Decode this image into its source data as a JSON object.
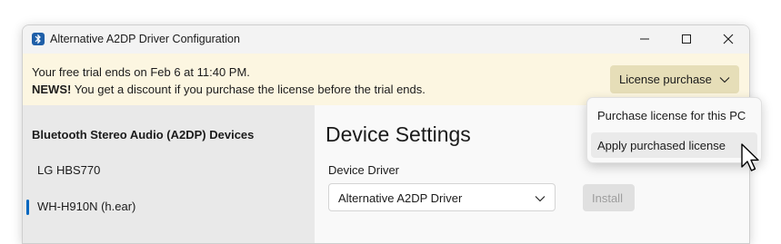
{
  "window": {
    "title": "Alternative A2DP Driver Configuration",
    "icon": "bluetooth-icon",
    "controls": [
      "minimize-icon",
      "maximize-icon",
      "close-icon"
    ]
  },
  "banner": {
    "trial_text": "Your free trial ends on Feb  6 at 11:40 PM.",
    "news_label": "NEWS!",
    "news_text": " You get a discount if you purchase the license before the trial ends.",
    "license_button": "License purchase",
    "background": "#fcf6e1"
  },
  "license_menu": {
    "items": [
      "Purchase license for this PC",
      "Apply purchased license"
    ],
    "hovered": "Apply purchased license"
  },
  "sidebar": {
    "header": "Bluetooth Stereo Audio (A2DP) Devices",
    "items": [
      {
        "label": "LG HBS770",
        "selected": false
      },
      {
        "label": "WH-H910N (h.ear)",
        "selected": true
      }
    ],
    "accent": "#0067c0"
  },
  "content": {
    "title": "Device Settings",
    "driver_label": "Device Driver",
    "driver_value": "Alternative A2DP Driver",
    "install_button": "Install",
    "install_enabled": false
  }
}
